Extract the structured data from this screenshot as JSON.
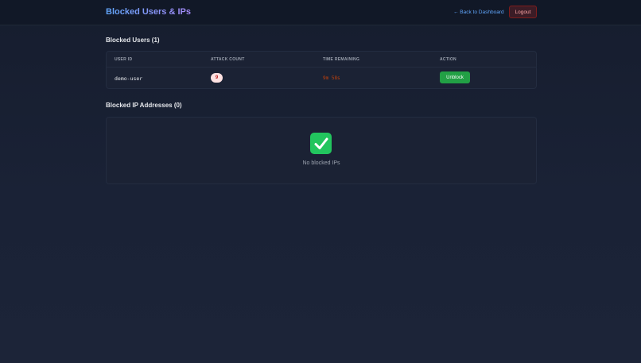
{
  "header": {
    "title": "Blocked Users & IPs",
    "back_link": "← Back to Dashboard",
    "logout_label": "Logout"
  },
  "blocked_users": {
    "title": "Blocked Users (1)",
    "columns": [
      "USER ID",
      "ATTACK COUNT",
      "TIME REMAINING",
      "ACTION"
    ],
    "rows": [
      {
        "user_id": "demo-user",
        "attack_count": "9",
        "time_remaining": "9m 58s",
        "action_label": "Unblock"
      }
    ]
  },
  "blocked_ips": {
    "title": "Blocked IP Addresses (0)",
    "empty_icon": "check-mark-icon",
    "empty_text": "No blocked IPs"
  },
  "colors": {
    "accent": "#60a5fa",
    "danger": "#b91c1c",
    "success": "#22a045"
  }
}
